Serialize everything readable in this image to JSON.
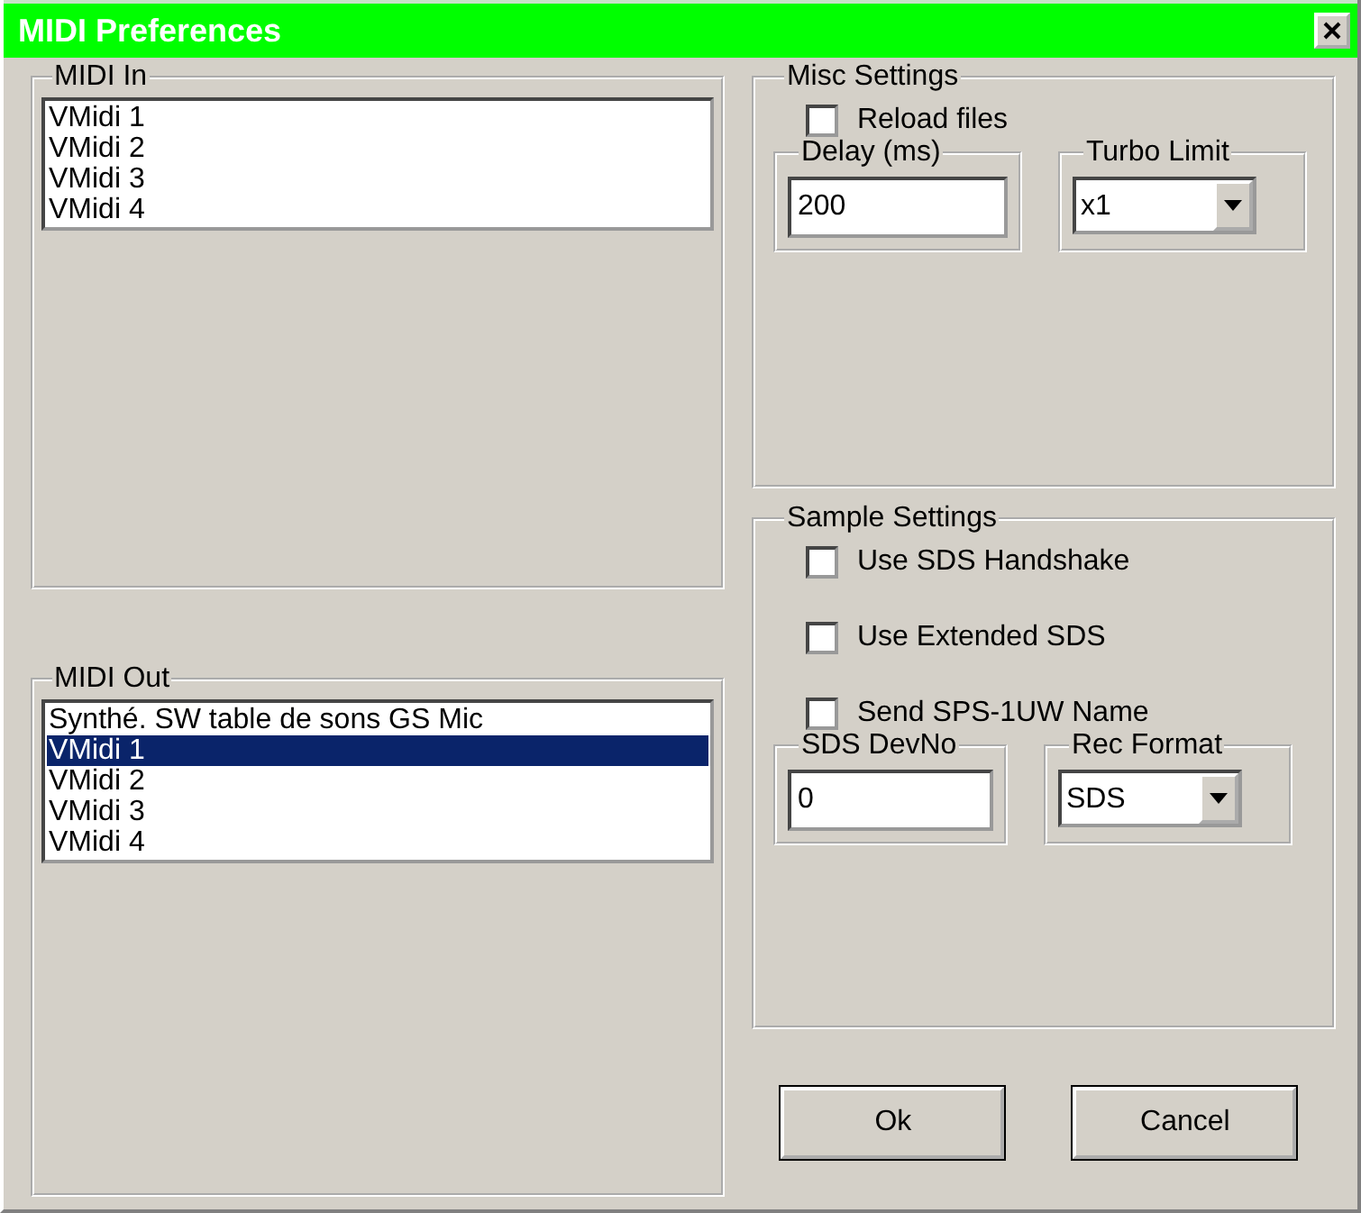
{
  "window": {
    "title": "MIDI Preferences"
  },
  "midi_in": {
    "label": "MIDI In",
    "items": [
      {
        "label": "VMidi 1",
        "selected": false
      },
      {
        "label": "VMidi 2",
        "selected": false
      },
      {
        "label": "VMidi 3",
        "selected": false
      },
      {
        "label": "VMidi 4",
        "selected": false
      }
    ]
  },
  "midi_out": {
    "label": "MIDI Out",
    "items": [
      {
        "label": "Synthé. SW table de sons GS Mic",
        "selected": false
      },
      {
        "label": "VMidi 1",
        "selected": true
      },
      {
        "label": "VMidi 2",
        "selected": false
      },
      {
        "label": "VMidi 3",
        "selected": false
      },
      {
        "label": "VMidi 4",
        "selected": false
      }
    ]
  },
  "misc_settings": {
    "label": "Misc Settings",
    "options": [
      {
        "label": "Reload files",
        "checked": false
      }
    ],
    "delay": {
      "label": "Delay (ms)",
      "value": "200"
    },
    "turbo_limit": {
      "label": "Turbo Limit",
      "value": "x1"
    }
  },
  "sample_settings": {
    "label": "Sample Settings",
    "options": [
      {
        "label": "Use SDS Handshake",
        "checked": false
      },
      {
        "label": "Use Extended SDS",
        "checked": false
      },
      {
        "label": "Send SPS-1UW Name",
        "checked": false
      }
    ],
    "sds_devno": {
      "label": "SDS DevNo",
      "value": "0"
    },
    "rec_format": {
      "label": "Rec Format",
      "value": "SDS"
    }
  },
  "buttons": [
    "Ok",
    "Cancel"
  ]
}
